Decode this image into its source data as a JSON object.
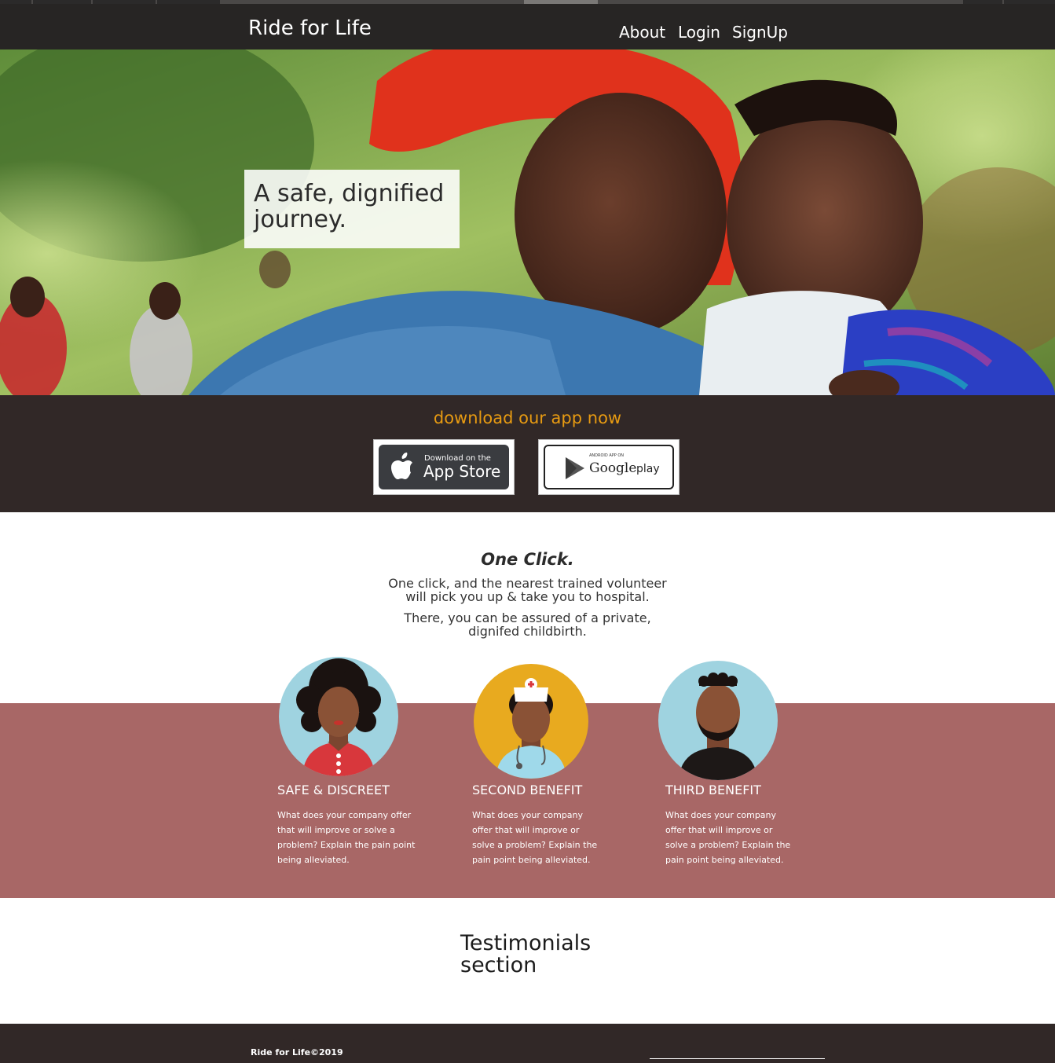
{
  "nav": {
    "brand": "Ride for Life",
    "links": [
      {
        "label": "About"
      },
      {
        "label": "Login"
      },
      {
        "label": "SignUp"
      }
    ]
  },
  "hero": {
    "tagline_line1": "A safe, dignified",
    "tagline_line2": "journey."
  },
  "download": {
    "title": "download our app now",
    "appstore_small": "Download on the",
    "appstore_large": "App Store",
    "googleplay_small": "ANDROID APP ON",
    "googleplay_brand": "Google",
    "googleplay_play": "play"
  },
  "one_click": {
    "title": "One Click.",
    "paragraph1": "One click, and the nearest trained volunteer will pick you up & take you to hospital.",
    "paragraph2": "There, you can be assured of a private, dignifed childbirth."
  },
  "benefits": [
    {
      "title": "SAFE & DISCREET",
      "text": "What does your company offer that will improve or solve a problem? Explain the pain point being alleviated.",
      "icon": "woman-avatar-icon"
    },
    {
      "title": "SECOND BENEFIT",
      "text": "What does your company offer that will improve or solve a problem? Explain the pain point being alleviated.",
      "icon": "nurse-avatar-icon"
    },
    {
      "title": "THIRD BENEFIT",
      "text": "What does your company offer that will improve or solve a problem? Explain the pain point being alleviated.",
      "icon": "man-avatar-icon"
    }
  ],
  "testimonials": {
    "title": "Testimonials section"
  },
  "footer": {
    "brand": "Ride for Life",
    "copyright": "©2019"
  },
  "colors": {
    "navbar": "#272524",
    "accent": "#e69a12",
    "benefit_band": "#a86766",
    "dark_band": "#312827"
  }
}
